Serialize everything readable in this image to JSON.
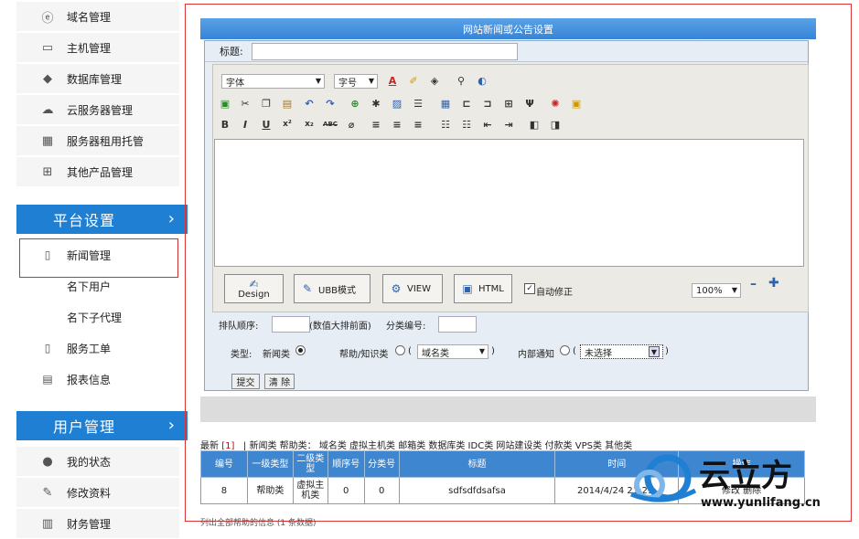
{
  "sidebar": {
    "top_items": [
      {
        "label": "域名管理",
        "icon": "e-icon"
      },
      {
        "label": "主机管理",
        "icon": "monitor-icon"
      },
      {
        "label": "数据库管理",
        "icon": "database-icon"
      },
      {
        "label": "云服务器管理",
        "icon": "cloud-icon"
      },
      {
        "label": "服务器租用托管",
        "icon": "server-icon"
      },
      {
        "label": "其他产品管理",
        "icon": "plus-box-icon"
      }
    ],
    "platform_header": "平台设置",
    "platform_items": [
      {
        "label": "新闻管理",
        "icon": "document-icon"
      },
      {
        "label": "名下用户"
      },
      {
        "label": "名下子代理"
      },
      {
        "label": "服务工单",
        "icon": "document-icon"
      },
      {
        "label": "报表信息",
        "icon": "chat-icon"
      }
    ],
    "user_header": "用户管理",
    "user_items": [
      {
        "label": "我的状态",
        "icon": "user-icon"
      },
      {
        "label": "修改资料",
        "icon": "edit-icon"
      },
      {
        "label": "财务管理",
        "icon": "finance-icon"
      }
    ]
  },
  "form": {
    "panel_title": "网站新闻或公告设置",
    "title_label": "标题:",
    "title_value": "",
    "font_select": "字体",
    "size_select": "字号",
    "modes": [
      "Design",
      "UBB模式",
      "VIEW",
      "HTML"
    ],
    "auto_fix_label": "自动修正",
    "zoom": "100%",
    "order_label": "排队顺序:",
    "order_note": "(数值大排前面)",
    "category_no_label": "分类编号:",
    "type_label": "类型:",
    "type_news": "新闻类",
    "type_help": "帮助/知识类",
    "help_open": "(",
    "help_select": "域名类",
    "help_close": ")",
    "type_internal": "内部通知",
    "internal_open": "(",
    "internal_select": "未选择",
    "internal_close": ")",
    "submit": "提交",
    "clear": "清 除"
  },
  "categories": {
    "latest": "最新",
    "latest_count": "[1]",
    "sep": "|",
    "news": "新闻类",
    "help_prefix": "帮助类：",
    "list": "域名类 虚拟主机类 邮箱类 数据库类 IDC类 网站建设类 付款类 VPS类 其他类"
  },
  "table": {
    "headers": [
      "编号",
      "一级类型",
      "二级类型",
      "顺序号",
      "分类号",
      "标题",
      "时间",
      "操作"
    ],
    "rows": [
      [
        "8",
        "帮助类",
        "虚拟主机类",
        "0",
        "0",
        "sdfsdfdsafsa",
        "2014/4/24 21:21:",
        "修改 删除"
      ]
    ]
  },
  "footer_note": "列出全部帮助的信息 (1 条数据)",
  "logo": {
    "name": "云立方",
    "url": "www.yunlifang.cn"
  },
  "colors": {
    "accent": "#1e7fd3",
    "header": "#3e86d0",
    "frame": "#d33"
  }
}
